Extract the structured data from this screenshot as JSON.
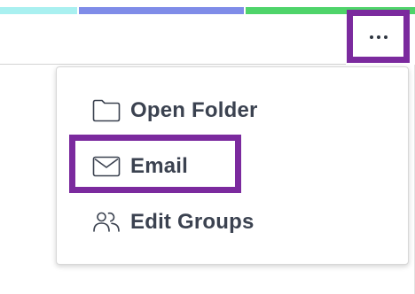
{
  "colors": {
    "stripe": [
      "#a9f0f0",
      "#7f8ce8",
      "#4fd46a"
    ],
    "highlight": "#7b2a9e",
    "text": "#3b4250",
    "icon": "#3b4250"
  },
  "header": {
    "more_button_icon": "ellipsis-icon"
  },
  "menu": {
    "items": [
      {
        "label": "Open Folder",
        "icon": "folder-icon"
      },
      {
        "label": "Email",
        "icon": "envelope-icon"
      },
      {
        "label": "Edit Groups",
        "icon": "people-icon"
      }
    ]
  }
}
